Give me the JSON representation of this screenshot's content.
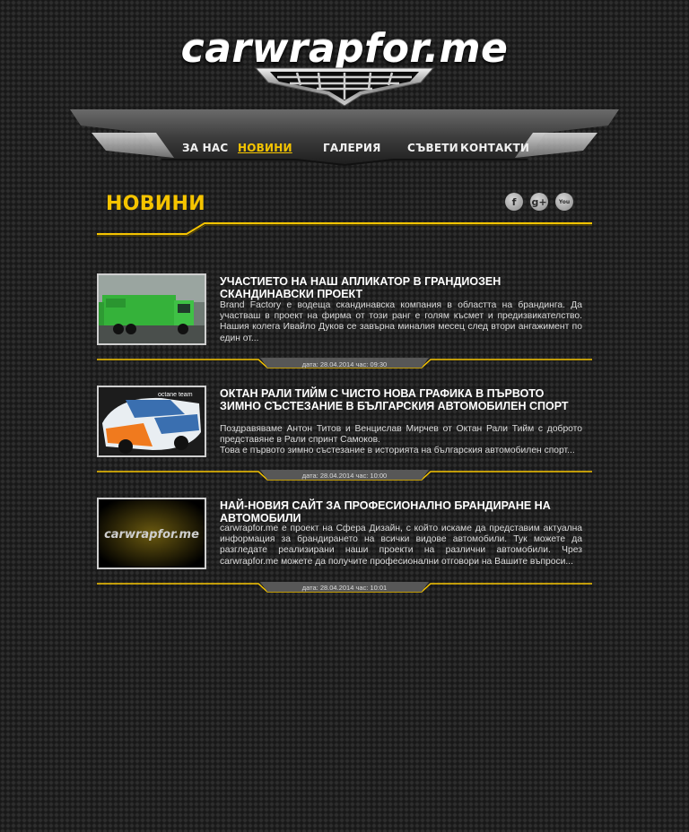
{
  "logo": {
    "text": "carwrapfor.me"
  },
  "nav": {
    "items": [
      {
        "label": "ЗА НАС"
      },
      {
        "label": "НОВИНИ"
      },
      {
        "label": "ГАЛЕРИЯ"
      },
      {
        "label": "СЪВЕТИ"
      },
      {
        "label": "КОНТАКТИ"
      }
    ],
    "active_index": 1
  },
  "page": {
    "title": "НОВИНИ"
  },
  "social": [
    {
      "icon": "facebook-icon",
      "glyph": "f"
    },
    {
      "icon": "google-plus-icon",
      "glyph": "g+"
    },
    {
      "icon": "youtube-icon",
      "glyph": "You"
    }
  ],
  "colors": {
    "accent": "#f5c400",
    "background": "#1f1f1f"
  },
  "articles": [
    {
      "title": "УЧАСТИЕТО НА НАШ АПЛИКАТОР В ГРАНДИОЗЕН СКАНДИНАВСКИ ПРОЕКТ",
      "text": "Brand Factory е водеща скандинавска компания в областта на брандинга. Да участваш в проект на фирма от този ранг е голям късмет и предизвикателство. Нашия колега Ивайло Дуков се завърна миналия месец след втори ангажимент по един от...",
      "text2": "",
      "date": "дата: 28.04.2014 час: 09:30"
    },
    {
      "title": "ОКТАН РАЛИ ТИЙМ С ЧИСТО НОВА ГРАФИКА В ПЪРВОТО ЗИМНО СЪСТЕЗАНИЕ В БЪЛГАРСКИЯ АВТОМОБИЛЕН СПОРТ",
      "text": "Поздравяваме Антон Титов и Венцислав Мирчев от Октан Рали Тийм с доброто представяне в Рали спринт Самоков.",
      "text2": "Това е първото зимно състезание в историята на българския автомобилен спорт...",
      "thumb_caption": "octane team",
      "date": "дата: 28.04.2014 час: 10:00"
    },
    {
      "title": "НАЙ-НОВИЯ САЙТ ЗА ПРОФЕСИОНАЛНО БРАНДИРАНЕ НА АВТОМОБИЛИ",
      "text": "carwrapfor.me е проект на Сфера Дизайн, с който искаме да представим актуална информация за брандирането на всички видове автомобили. Тук можете да разгледате реализирани наши проекти на различни автомобили. Чрез carwrapfor.me можете да получите професионални отговори на Вашите въпроси...",
      "text2": "",
      "thumb_caption": "carwrapfor.me",
      "date": "дата: 28.04.2014 час: 10:01"
    }
  ]
}
